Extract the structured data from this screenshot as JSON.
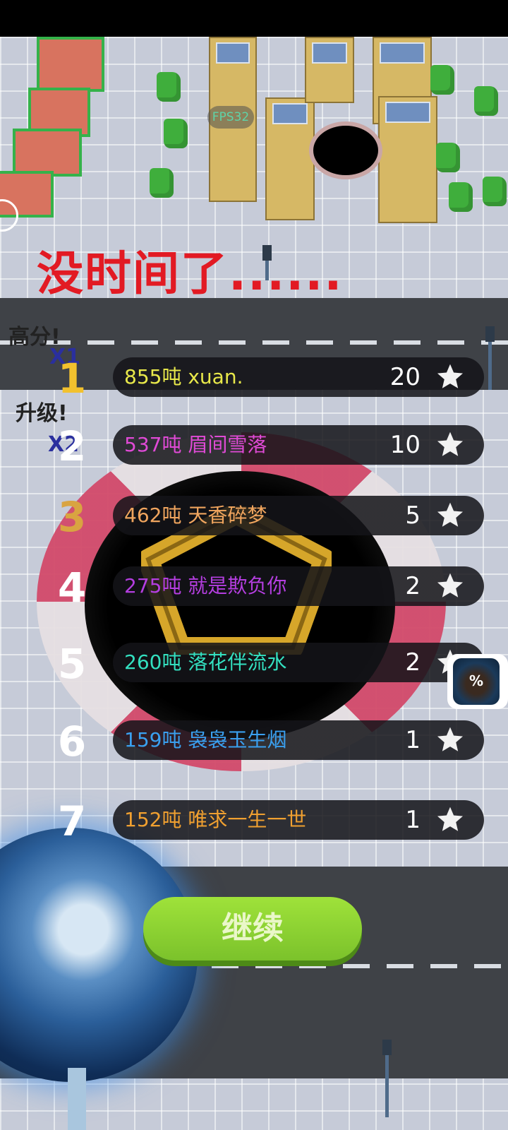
{
  "hud": {
    "fps": "FPS32",
    "title": "没时间了......",
    "bonus_score_label": "高分!",
    "bonus_score_multiplier": "X1",
    "bonus_upgrade_label": "升级!",
    "bonus_upgrade_multiplier": "X2",
    "skin_badge": "%"
  },
  "leaderboard": [
    {
      "rank": "1",
      "name": "855吨 xuan.",
      "stars": "20",
      "rank_color": "#f2c12e",
      "name_color": "#e8e84a"
    },
    {
      "rank": "2",
      "name": "537吨 眉间雪落",
      "stars": "10",
      "rank_color": "#ffffff",
      "name_color": "#e04ad6"
    },
    {
      "rank": "3",
      "name": "462吨 天香碎梦",
      "stars": "5",
      "rank_color": "#d9a441",
      "name_color": "#f0a55e"
    },
    {
      "rank": "4",
      "name": "275吨 就是欺负你",
      "stars": "2",
      "rank_color": "#ffffff",
      "name_color": "#b43ee0"
    },
    {
      "rank": "5",
      "name": "260吨 落花伴流水",
      "stars": "2",
      "rank_color": "#ffffff",
      "name_color": "#33e0c0"
    },
    {
      "rank": "6",
      "name": "159吨 袅袅玉生烟",
      "stars": "1",
      "rank_color": "#ffffff",
      "name_color": "#3aa0f0"
    },
    {
      "rank": "7",
      "name": "152吨 唯求一生一世",
      "stars": "1",
      "rank_color": "#ffffff",
      "name_color": "#f0a030"
    }
  ],
  "continue_button": "继续",
  "colors": {
    "title": "#e21a23",
    "continue": "#8ed130"
  }
}
